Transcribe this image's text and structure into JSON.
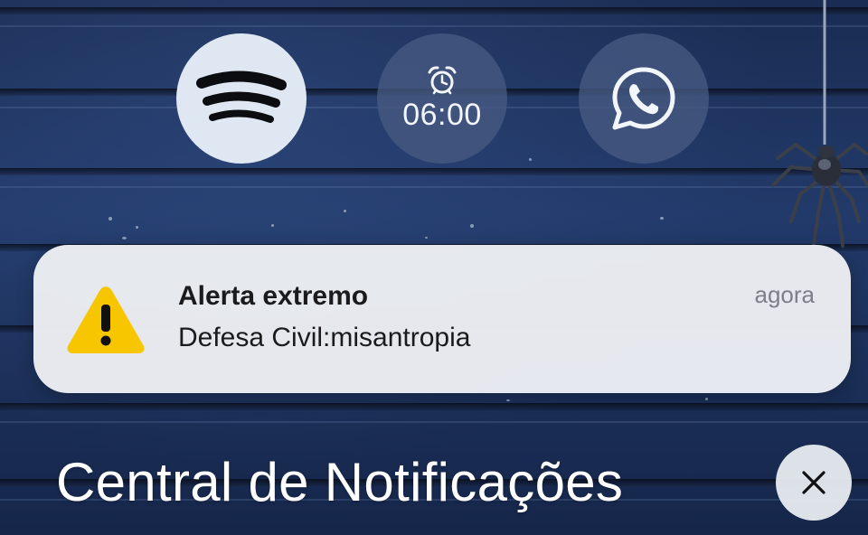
{
  "quick_actions": [
    {
      "name": "Spotify",
      "icon": "spotify-icon"
    },
    {
      "name": "Alarm",
      "icon": "alarm-clock-icon",
      "time": "06:00"
    },
    {
      "name": "WhatsApp",
      "icon": "whatsapp-icon"
    }
  ],
  "notification": {
    "icon": "warning-triangle-icon",
    "title": "Alerta extremo",
    "body": "Defesa Civil:misantropia",
    "time": "agora"
  },
  "notification_center": {
    "title": "Central de Notificações",
    "close_icon": "close-icon"
  },
  "colors": {
    "warning": "#F7C600",
    "card": "#ECEEF3",
    "wallpaper": "#1F3463"
  }
}
